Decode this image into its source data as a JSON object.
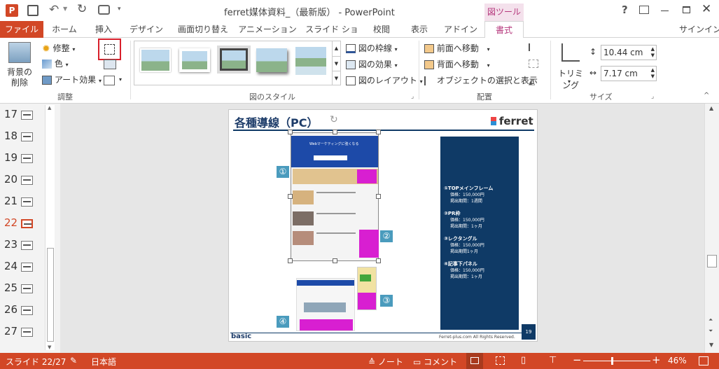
{
  "window": {
    "title": "ferret媒体資料_（最新版） - PowerPoint",
    "tool_context": "図ツール",
    "help": "?",
    "signin": "サインイン"
  },
  "tabs": [
    {
      "label": "ファイル",
      "active": false,
      "file": true
    },
    {
      "label": "ホーム"
    },
    {
      "label": "挿入"
    },
    {
      "label": "デザイン"
    },
    {
      "label": "画面切り替え"
    },
    {
      "label": "アニメーション"
    },
    {
      "label": "スライド ショー"
    },
    {
      "label": "校閲"
    },
    {
      "label": "表示"
    },
    {
      "label": "アドイン"
    },
    {
      "label": "書式",
      "active": true
    }
  ],
  "ribbon": {
    "adjust": {
      "remove_bg": "背景の削除",
      "corrections": "修整",
      "color": "色",
      "artistic": "アート効果",
      "group_label": "調整"
    },
    "styles": {
      "group_label": "図のスタイル",
      "border": "図の枠線",
      "effects": "図の効果",
      "layout": "図のレイアウト"
    },
    "arrange": {
      "group_label": "配置",
      "bring_forward": "前面へ移動",
      "send_backward": "背面へ移動",
      "selection_pane": "オブジェクトの選択と表示"
    },
    "size": {
      "group_label": "サイズ",
      "crop": "トリミング",
      "height": "10.44 cm",
      "width": "7.17 cm"
    }
  },
  "thumbnails": [
    "17",
    "18",
    "19",
    "20",
    "21",
    "22",
    "23",
    "24",
    "25",
    "26",
    "27"
  ],
  "selected_thumbnail": "22",
  "slide": {
    "title": "各種導線（PC）",
    "logo": "ferret",
    "items": [
      {
        "head": "①TOPメインフレーム",
        "price": "価格：150,000円",
        "period": "掲出期間：1週間"
      },
      {
        "head": "②PR枠",
        "price": "価格：150,000円",
        "period": "掲出期間：1ヶ月"
      },
      {
        "head": "③レクタングル",
        "price": "価格：150,000円",
        "period": "掲出期間1ヶ月"
      },
      {
        "head": "④記事下パネル",
        "price": "価格：150,000円",
        "period": "掲出期間：1ヶ月"
      }
    ],
    "callouts": [
      "①",
      "②",
      "③",
      "④"
    ],
    "footer_left": "basic",
    "footer_center": "Ferret-plus.com  All Rights Reserved.",
    "page_number": "19",
    "mock_banner": "Webマーケティングに強くなる"
  },
  "status": {
    "slide": "スライド 22/27",
    "language": "日本語",
    "notes": "ノート",
    "comments": "コメント",
    "zoom": "46%"
  },
  "colors": {
    "accent": "#d24726",
    "tool_tab": "#b5377c",
    "slide_navy": "#0f3a66",
    "callout_blue": "#4a9bbd",
    "magenta": "#d81fd1"
  }
}
